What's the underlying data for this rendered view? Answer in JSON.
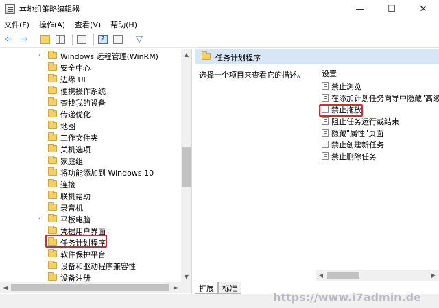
{
  "window": {
    "title": "本地组策略编辑器",
    "minimize_glyph": "—",
    "maximize_glyph": "☐",
    "close_glyph": "✕"
  },
  "menu": [
    "文件(F)",
    "操作(A)",
    "查看(V)",
    "帮助(H)"
  ],
  "toolbar": {
    "back_glyph": "⇦",
    "forward_glyph": "⇨",
    "help_glyph": "?",
    "filter_glyph": "▽"
  },
  "tree": {
    "items": [
      {
        "label": "Windows 远程管理(WinRM)",
        "expander": "›"
      },
      {
        "label": "安全中心",
        "expander": ""
      },
      {
        "label": "边缘 UI",
        "expander": ""
      },
      {
        "label": "便携操作系统",
        "expander": ""
      },
      {
        "label": "查找我的设备",
        "expander": ""
      },
      {
        "label": "传递优化",
        "expander": ""
      },
      {
        "label": "地图",
        "expander": ""
      },
      {
        "label": "工作文件夹",
        "expander": ""
      },
      {
        "label": "关机选项",
        "expander": ""
      },
      {
        "label": "家庭组",
        "expander": ""
      },
      {
        "label": "将功能添加到 Windows 10",
        "expander": ""
      },
      {
        "label": "连接",
        "expander": ""
      },
      {
        "label": "联机帮助",
        "expander": ""
      },
      {
        "label": "录音机",
        "expander": ""
      },
      {
        "label": "平板电脑",
        "expander": "›"
      },
      {
        "label": "凭据用户界面",
        "expander": ""
      },
      {
        "label": "任务计划程序",
        "expander": ""
      },
      {
        "label": "软件保护平台",
        "expander": ""
      },
      {
        "label": "设备和驱动程序兼容性",
        "expander": ""
      },
      {
        "label": "设备注册",
        "expander": ""
      }
    ],
    "selected": "任务计划程序",
    "scroll_up_glyph": "▲",
    "scroll_down_glyph": "▼",
    "scroll_left_glyph": "◀",
    "scroll_right_glyph": "▶"
  },
  "detail": {
    "header": "任务计划程序",
    "description": "选择一个项目来查看它的描述。",
    "column_header": "设置",
    "settings": [
      "禁止浏览",
      "在添加计划任务向导中隐藏\"高级属",
      "禁止拖放",
      "阻止任务运行或结束",
      "隐藏\"属性\"页面",
      "禁止创建新任务",
      "禁止删除任务"
    ],
    "highlighted_setting": "禁止拖放",
    "tabs": [
      "扩展",
      "标准"
    ],
    "active_tab": "扩展"
  },
  "watermark": "https://www.i7admin.de"
}
